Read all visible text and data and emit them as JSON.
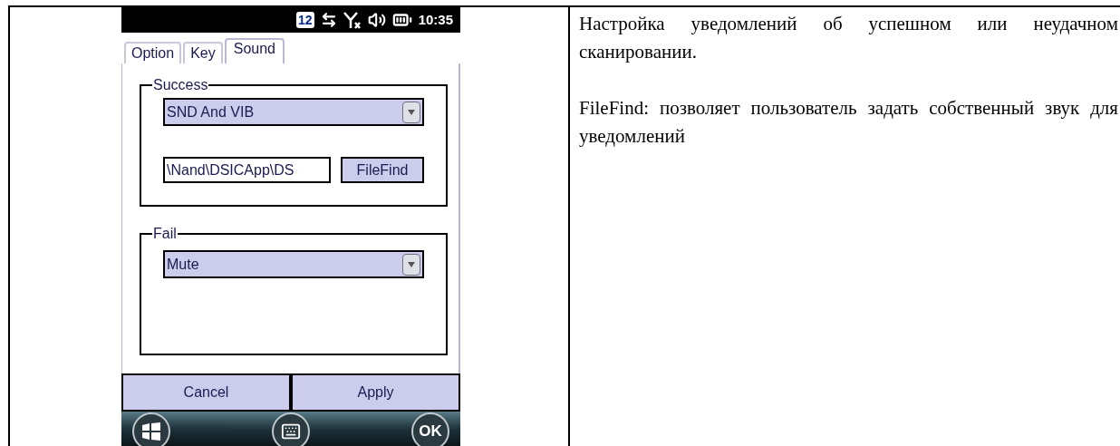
{
  "status_bar": {
    "badge": "12",
    "time": "10:35"
  },
  "tabs": [
    {
      "label": "Option",
      "selected": false
    },
    {
      "label": "Key",
      "selected": false
    },
    {
      "label": "Sound",
      "selected": true
    }
  ],
  "success": {
    "legend": "Success",
    "select": "SND And VIB",
    "path": "\\Nand\\DSICApp\\DS",
    "button": "FileFind"
  },
  "fail": {
    "legend": "Fail",
    "select": "Mute"
  },
  "buttons": [
    "Cancel",
    "Apply"
  ],
  "softkeys": {
    "ok": "OK"
  },
  "description": [
    "Настройка уведомлений об успешном или неудачном сканировании.",
    "FileFind: позволяет пользователь задать собственный звук для уведомлений"
  ]
}
